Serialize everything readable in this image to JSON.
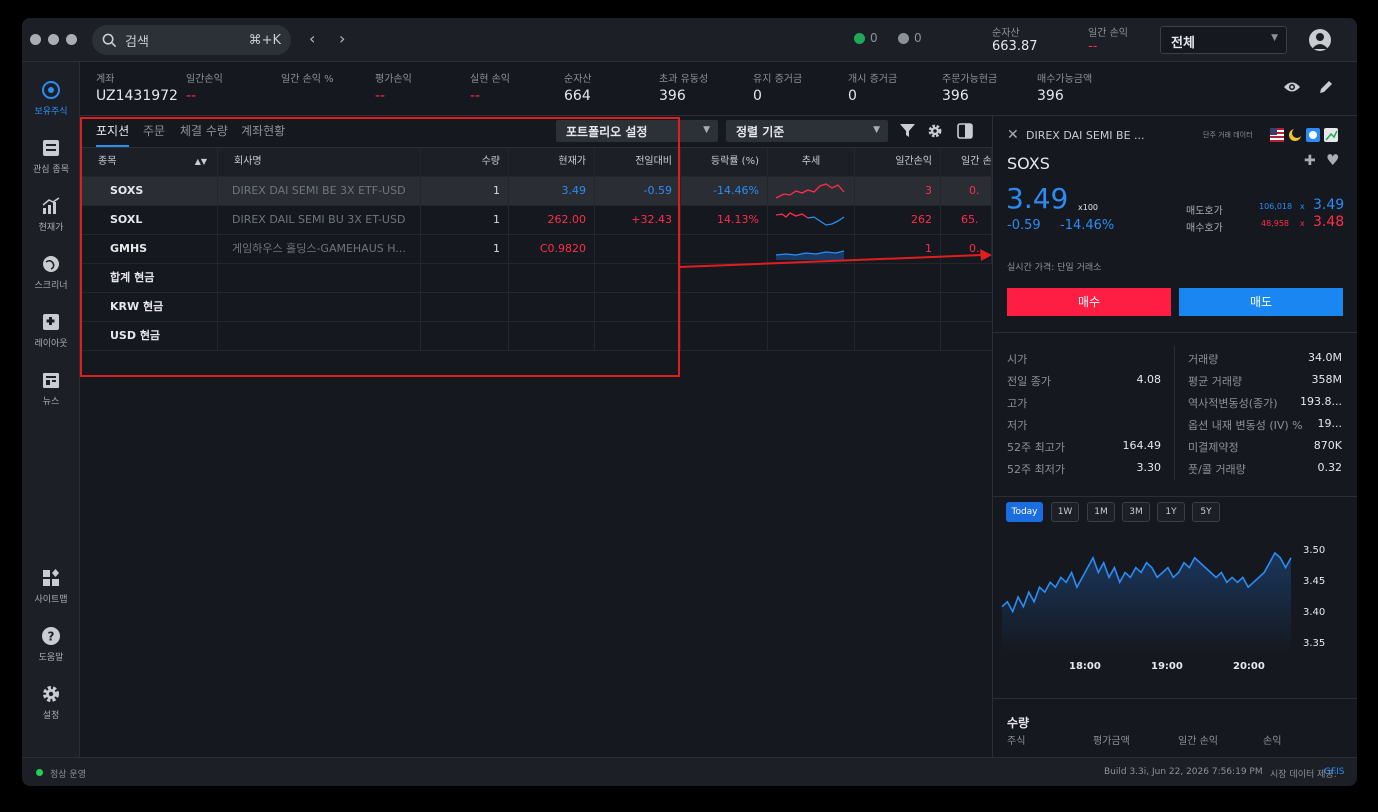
{
  "topbar": {
    "search_placeholder": "검색",
    "search_shortcut": "⌘+K",
    "stat_filled": "0",
    "stat_working": "0",
    "net_assets_label": "순자산",
    "net_assets_value": "663.87",
    "daily_pl_label": "일간 손익",
    "daily_pl_value": "--",
    "account_select": "전체"
  },
  "sidebar": {
    "items": [
      {
        "label": "보유주식",
        "icon": "portfolio-icon"
      },
      {
        "label": "관심 종목",
        "icon": "watchlist-icon"
      },
      {
        "label": "현재가",
        "icon": "quote-icon"
      },
      {
        "label": "스크리너",
        "icon": "screener-icon"
      },
      {
        "label": "레이아웃",
        "icon": "layout-icon"
      },
      {
        "label": "뉴스",
        "icon": "news-icon"
      },
      {
        "label": "사이트맵",
        "icon": "sitemap-icon"
      },
      {
        "label": "도움말",
        "icon": "help-icon"
      },
      {
        "label": "설정",
        "icon": "settings-icon"
      }
    ]
  },
  "account": {
    "fields": [
      {
        "label": "계좌",
        "value": "UZ1431972"
      },
      {
        "label": "일간손익",
        "value": "--"
      },
      {
        "label": "일간 손익 %",
        "value": ""
      },
      {
        "label": "평가손익",
        "value": "--"
      },
      {
        "label": "실현 손익",
        "value": "--"
      },
      {
        "label": "순자산",
        "value": "664"
      },
      {
        "label": "초과 유동성",
        "value": "396"
      },
      {
        "label": "유지 증거금",
        "value": "0"
      },
      {
        "label": "개시 증거금",
        "value": "0"
      },
      {
        "label": "주문가능현금",
        "value": "396"
      },
      {
        "label": "매수가능금액",
        "value": "396"
      }
    ]
  },
  "positions": {
    "tabs": [
      "포지션",
      "주문",
      "체결 수량",
      "계좌현황"
    ],
    "portfolio_dropdown": "포트폴리오 설정",
    "sort_dropdown": "정렬 기준",
    "headers": [
      "종목",
      "회사명",
      "수량",
      "현재가",
      "전일대비",
      "등락률 (%)",
      "추세",
      "일간손익",
      "일간 손"
    ],
    "rows": [
      {
        "symbol": "SOXS",
        "company": "DIREX DAI SEMI BE 3X ETF-USD",
        "qty": "1",
        "price": "3.49",
        "change": "-0.59",
        "pct": "-14.46%",
        "pl": "3",
        "pl2": "0."
      },
      {
        "symbol": "SOXL",
        "company": "DIREX DAIL SEMI BU 3X ET-USD",
        "qty": "1",
        "price": "262.00",
        "change": "+32.43",
        "pct": "14.13%",
        "pl": "262",
        "pl2": "65."
      },
      {
        "symbol": "GMHS",
        "company": "게임하우스 홀딩스-GAMEHAUS H...",
        "qty": "1",
        "price": "C0.9820",
        "change": "",
        "pct": "",
        "pl": "1",
        "pl2": "0."
      },
      {
        "symbol": "합계 현금",
        "company": "",
        "qty": "",
        "price": "",
        "change": "",
        "pct": "",
        "pl": "",
        "pl2": ""
      },
      {
        "symbol": "KRW 현금",
        "company": "",
        "qty": "",
        "price": "",
        "change": "",
        "pct": "",
        "pl": "",
        "pl2": ""
      },
      {
        "symbol": "USD 현금",
        "company": "",
        "qty": "",
        "price": "",
        "change": "",
        "pct": "",
        "pl": "",
        "pl2": ""
      }
    ]
  },
  "quote": {
    "name": "DIREX DAI SEMI BE ...",
    "data_label": "단주 거래 데이터",
    "symbol": "SOXS",
    "price": "3.49",
    "multiplier": "x100",
    "change": "-0.59",
    "change_pct": "-14.46%",
    "ask_label": "매도호가",
    "ask_size": "106,018",
    "ask_price": "3.49",
    "bid_label": "매수호가",
    "bid_size": "48,958",
    "bid_price": "3.48",
    "times_sign": "x",
    "realtime_note": "실시간 가격: 단일 거래소",
    "buy_label": "매수",
    "sell_label": "매도",
    "stats_left": [
      {
        "label": "시가",
        "value": ""
      },
      {
        "label": "전일 종가",
        "value": "4.08"
      },
      {
        "label": "고가",
        "value": ""
      },
      {
        "label": "저가",
        "value": ""
      },
      {
        "label": "52주 최고가",
        "value": "164.49"
      },
      {
        "label": "52주 최저가",
        "value": "3.30"
      }
    ],
    "stats_right": [
      {
        "label": "거래량",
        "value": "34.0M"
      },
      {
        "label": "평균 거래량",
        "value": "358M"
      },
      {
        "label": "역사적변동성(종가)",
        "value": "193.8..."
      },
      {
        "label": "옵션 내재 변동성 (IV) %",
        "value": "19..."
      },
      {
        "label": "미결제약정",
        "value": "870K"
      },
      {
        "label": "풋/콜 거래량",
        "value": "0.32"
      }
    ],
    "ranges": [
      "Today",
      "1W",
      "1M",
      "3M",
      "1Y",
      "5Y"
    ],
    "holding_title": "수량",
    "holding_cols": [
      "주식",
      "평가금액",
      "일간 손익",
      "손익"
    ]
  },
  "chart_data": {
    "type": "area",
    "x_ticks": [
      "18:00",
      "19:00",
      "20:00"
    ],
    "y_ticks": [
      "3.50",
      "3.45",
      "3.40",
      "3.35"
    ],
    "ylim": [
      3.33,
      3.52
    ],
    "values": [
      3.4,
      3.41,
      3.39,
      3.42,
      3.4,
      3.43,
      3.41,
      3.44,
      3.43,
      3.45,
      3.44,
      3.46,
      3.45,
      3.47,
      3.44,
      3.46,
      3.48,
      3.5,
      3.47,
      3.49,
      3.46,
      3.48,
      3.45,
      3.47,
      3.46,
      3.48,
      3.47,
      3.49,
      3.48,
      3.46,
      3.47,
      3.48,
      3.46,
      3.47,
      3.49,
      3.48,
      3.5,
      3.49,
      3.48,
      3.47,
      3.46,
      3.47,
      3.45,
      3.46,
      3.45,
      3.46,
      3.44,
      3.45,
      3.46,
      3.47,
      3.49,
      3.51,
      3.5,
      3.48,
      3.5
    ]
  },
  "status": {
    "state": "정상 운영",
    "build": "Build 3.3i, Jun 22, 2026 7:56:19 PM",
    "provider_label": "시장 데이터 제공:",
    "provider": "GFIS"
  }
}
